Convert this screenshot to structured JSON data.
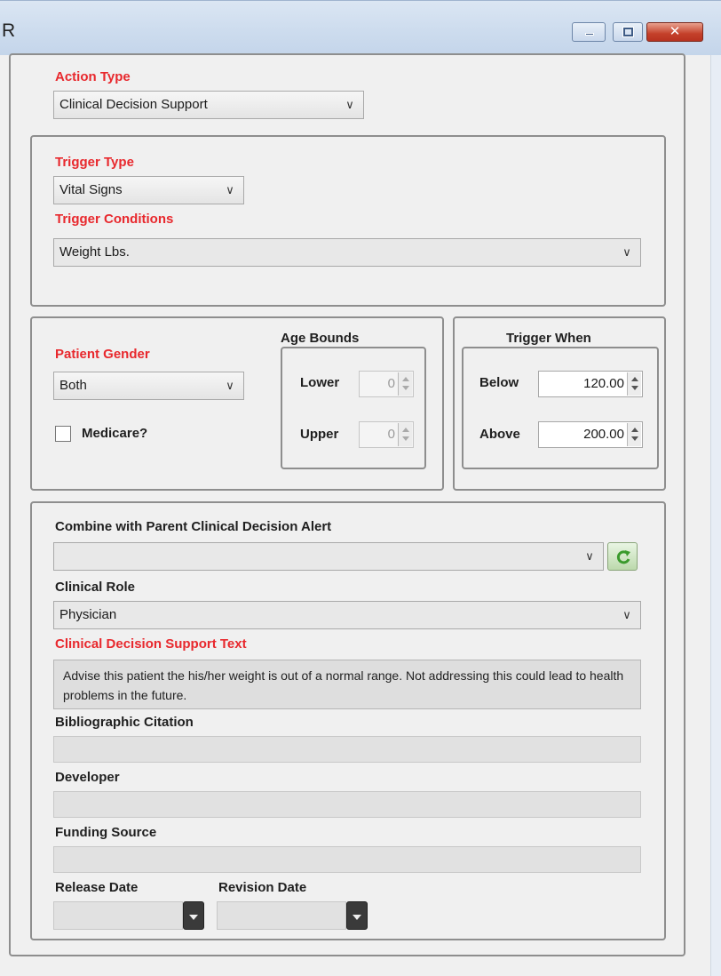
{
  "window": {
    "title": "R"
  },
  "action": {
    "label": "Action Type",
    "value": "Clinical Decision Support"
  },
  "trigger": {
    "type_label": "Trigger Type",
    "type_value": "Vital Signs",
    "conditions_label": "Trigger Conditions",
    "conditions_value": "Weight Lbs."
  },
  "patient": {
    "gender_label": "Patient Gender",
    "gender_value": "Both",
    "medicare_label": "Medicare?",
    "medicare_checked": false
  },
  "age_bounds": {
    "title": "Age Bounds",
    "lower_label": "Lower",
    "lower_value": "0",
    "upper_label": "Upper",
    "upper_value": "0"
  },
  "trigger_when": {
    "title": "Trigger When",
    "below_label": "Below",
    "below_value": "120.00",
    "above_label": "Above",
    "above_value": "200.00"
  },
  "details": {
    "combine_label": "Combine with Parent Clinical Decision Alert",
    "combine_value": "",
    "role_label": "Clinical Role",
    "role_value": "Physician",
    "cds_text_label": "Clinical Decision Support Text",
    "cds_text_value": "Advise this patient the his/her weight is out of a normal range.  Not addressing this could lead to health problems in the future.",
    "citation_label": "Bibliographic Citation",
    "citation_value": "",
    "developer_label": "Developer",
    "developer_value": "",
    "funding_label": "Funding Source",
    "funding_value": "",
    "release_label": "Release Date",
    "release_value": "",
    "revision_label": "Revision Date",
    "revision_value": ""
  },
  "icons": {
    "minimize": "minimize-icon",
    "maximize": "maximize-icon",
    "close": "close-icon",
    "refresh": "refresh-icon",
    "dropdown": "chevron-down-icon",
    "calendar_dropdown": "calendar-dropdown-icon"
  },
  "colors": {
    "required_label": "#e8282d",
    "refresh_icon": "#3a9a2c",
    "titlebar": "#cddcee",
    "close_button": "#c4402a"
  }
}
